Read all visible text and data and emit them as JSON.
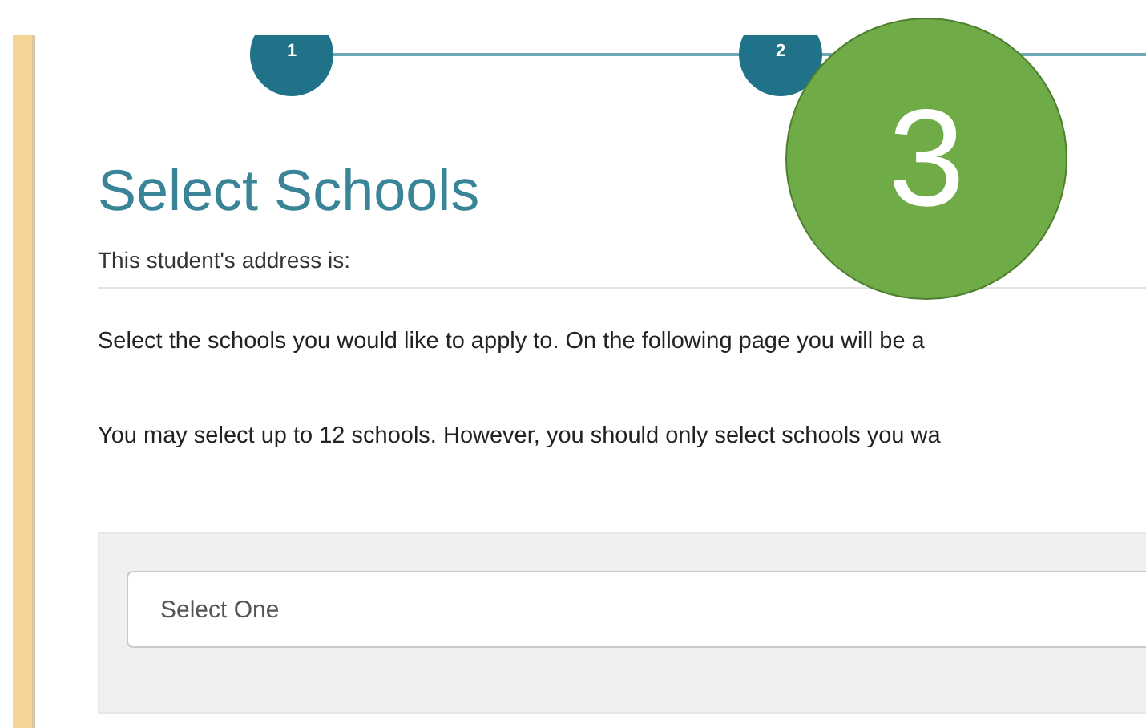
{
  "steps": [
    {
      "label": "1"
    },
    {
      "label": "2"
    }
  ],
  "callout": {
    "label": "3"
  },
  "heading": "Select Schools",
  "address_label": "This student's address is:",
  "paragraphs": [
    "Select the schools you would like to apply to. On the following page you will be a",
    "You may select up to 12 schools. However, you should only select schools you wa"
  ],
  "school_select": {
    "placeholder": "Select One"
  }
}
